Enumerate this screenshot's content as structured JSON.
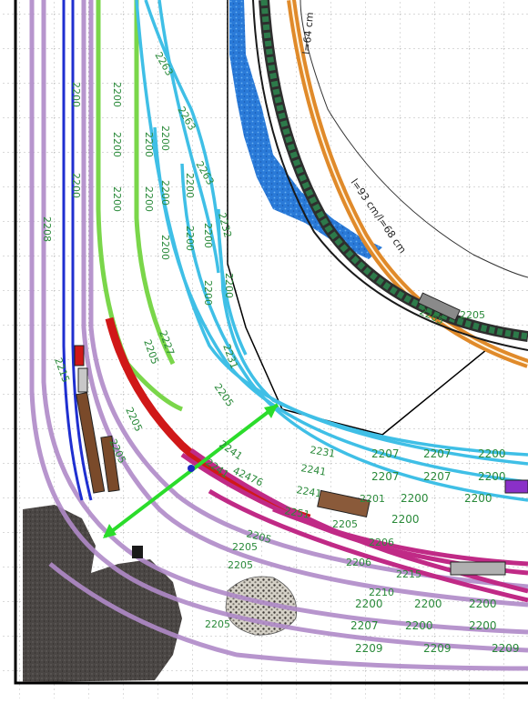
{
  "canvas_title": "",
  "measurements": [
    {
      "id": "m1",
      "text": "l=64 cm"
    },
    {
      "id": "m2",
      "text": "l=93 cm/l=68 cm"
    }
  ],
  "track_labels": {
    "t2200": "2200",
    "t2263": "2263",
    "t2205": "2205",
    "t2207": "2207",
    "t2209": "2209",
    "t2231": "2231",
    "t2241": "2241",
    "t2251": "2251",
    "t2201": "2201",
    "t2206": "2206",
    "t2215": "2215",
    "t2210": "2210",
    "t42476": "42476",
    "t2232": "2232",
    "t2227": "2227",
    "t2265": "2265",
    "t2208": "2208"
  },
  "colors": {
    "grid": "#9a9a9a",
    "cyan_track": "#3fbfe6",
    "green_track": "#7ad64a",
    "blue_track": "#1f2fd0",
    "purple_track": "#b08ac8",
    "magenta_track": "#c02a86",
    "red_track": "#d01818",
    "orange_track": "#e08a2a",
    "water": "#2a7ad8",
    "rock": "#4a4644",
    "arrow": "#2bdc2b",
    "label": "#2a8a3a"
  }
}
